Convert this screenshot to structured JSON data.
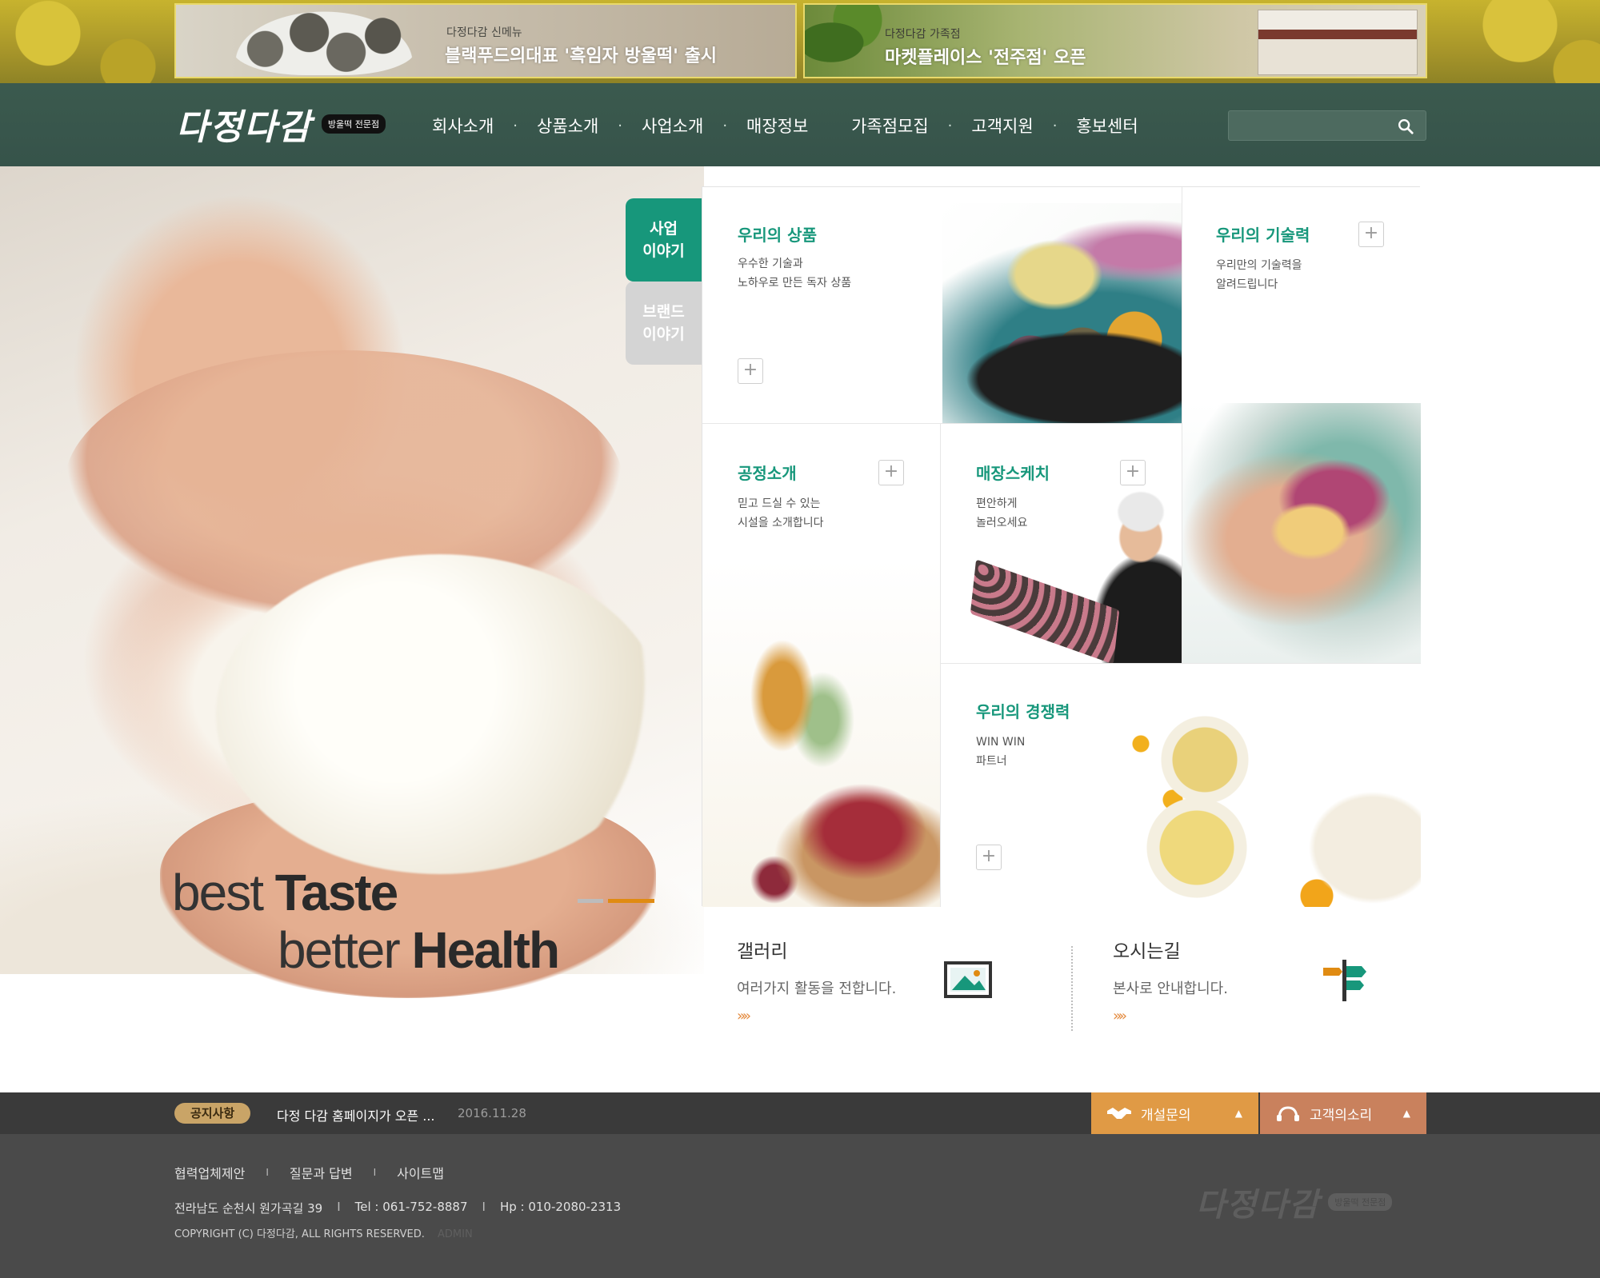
{
  "promos": [
    {
      "sub": "다정다감 신메뉴",
      "head": "블랙푸드의대표 '흑임자 방울떡' 출시"
    },
    {
      "sub": "다정다감 가족점",
      "head": "마켓플레이스 '전주점' 오픈"
    }
  ],
  "brand": {
    "logo": "다정다감",
    "badge": "방울떡 전문점"
  },
  "nav": {
    "items": [
      "회사소개",
      "상품소개",
      "사업소개",
      "매장정보",
      "가족점모집",
      "고객지원",
      "홍보센터"
    ],
    "separator": "·"
  },
  "search": {
    "placeholder": ""
  },
  "hero": {
    "line1_light": "best",
    "line1_bold": "Taste",
    "line2_light": "better",
    "line2_bold": "Health"
  },
  "side_tabs": [
    {
      "line1": "사업",
      "line2": "이야기",
      "active": true
    },
    {
      "line1": "브랜드",
      "line2": "이야기",
      "active": false
    }
  ],
  "cards": {
    "product": {
      "title": "우리의 상품",
      "line1": "우수한 기술과",
      "line2": "노하우로 만든 독자 상품",
      "plus": "+"
    },
    "tech": {
      "title": "우리의 기술력",
      "line1": "우리만의 기술력을",
      "line2": "알려드립니다",
      "plus": "+"
    },
    "process": {
      "title": "공정소개",
      "line1": "믿고 드실 수 있는",
      "line2": "시설을 소개합니다",
      "plus": "+"
    },
    "store": {
      "title": "매장스케치",
      "line1": "편안하게",
      "line2": "놀러오세요",
      "plus": "+"
    },
    "compete": {
      "title": "우리의 경쟁력",
      "line1": "WIN WIN",
      "line2": "파트너",
      "plus": "+"
    }
  },
  "info": {
    "gallery": {
      "title": "갤러리",
      "desc": "여러가지 활동을 전합니다.",
      "arrow": "»»"
    },
    "map": {
      "title": "오시는길",
      "desc": "본사로 안내합니다.",
      "arrow": "»»"
    }
  },
  "notice": {
    "badge": "공지사항",
    "text": "다정 다감 홈페이지가 오픈 ...",
    "date": "2016.11.28"
  },
  "footer_buttons": [
    {
      "label": "개설문의",
      "arrow": "▲"
    },
    {
      "label": "고객의소리",
      "arrow": "▲"
    }
  ],
  "footer": {
    "links": [
      "협력업체제안",
      "질문과 답변",
      "사이트맵"
    ],
    "link_sep": "I",
    "address": "전라남도 순천시 원가곡길 39",
    "tel": "Tel : 061-752-8887",
    "hp": "Hp : 010-2080-2313",
    "addr_sep": "I",
    "copyright": "COPYRIGHT (C) 다정다감, ALL RIGHTS RESERVED.",
    "admin": "ADMIN",
    "logo": "다정다감",
    "badge": "방울떡 전문점"
  },
  "colors": {
    "nav_bg": "#3b5a4e",
    "accent_green": "#17977b",
    "slider_active": "#e08b12",
    "notice_badge": "#c9a467",
    "btn_open": "#e09a45",
    "btn_voice": "#c9815d",
    "footer_bg": "#4a4a4a"
  }
}
